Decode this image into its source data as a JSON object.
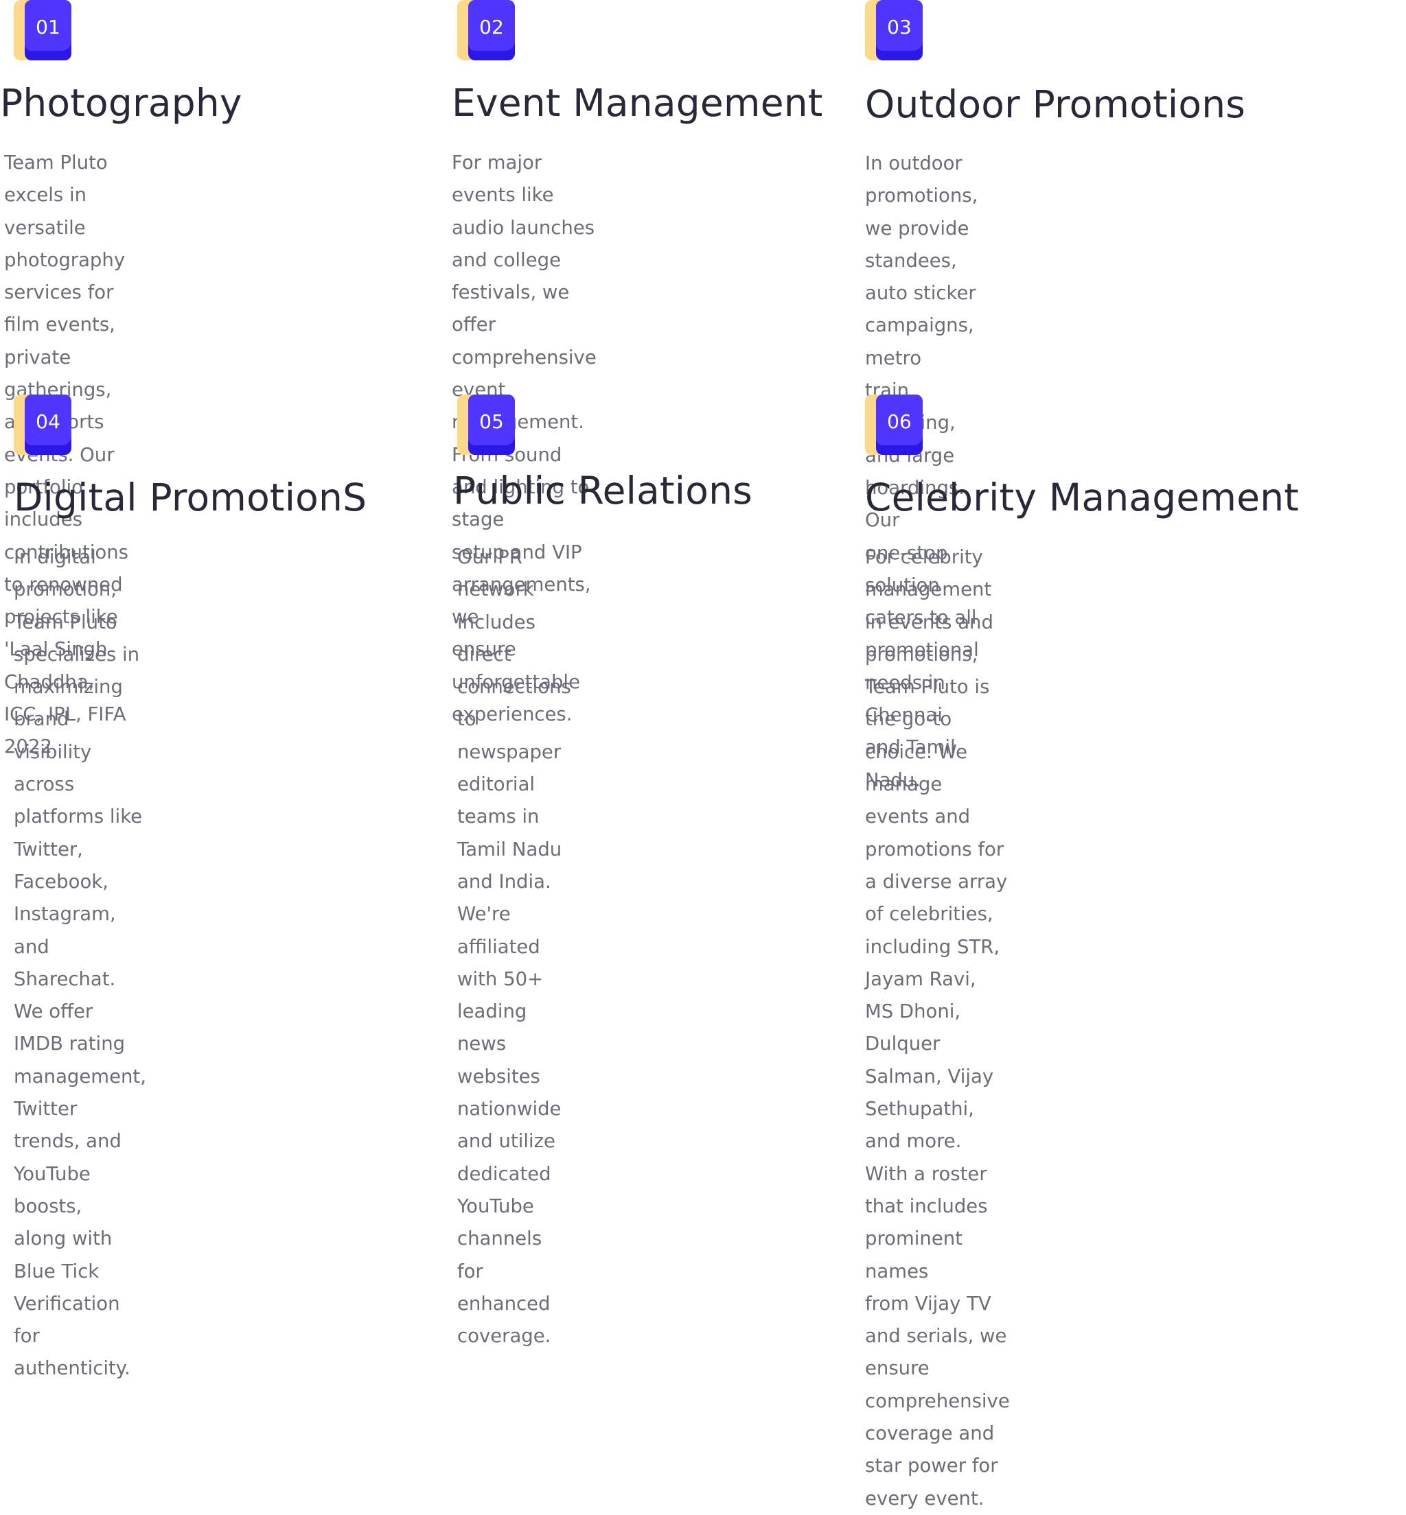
{
  "services": [
    {
      "number": "01",
      "title": "Photography",
      "description": "Team Pluto excels in versatile photography\nservices for film events, private gatherings,\nand sports events. Our portfolio includes\ncontributions to renowned projects like\n'Laal Singh Chaddha, ICC, IPL, FIFA 2022."
    },
    {
      "number": "02",
      "title": "Event Management",
      "description": "For major events like audio launches\nand college festivals, we offer\ncomprehensive event management.\nFrom sound and lighting to stage\nsetup and VIP arrangements, we\nensure unforgettable experiences."
    },
    {
      "number": "03",
      "title": "Outdoor Promotions",
      "description": "In outdoor promotions, we provide\nstandees, auto sticker campaigns, metro\ntrain branding, and large hoardings. Our\none-stop solution caters to all promotional\nneeds in Chennai and Tamil Nadu."
    },
    {
      "number": "04",
      "title": "Digital PromotionS",
      "description": "In digital promotion, Team Pluto\nspecializes in maximizing brand\nvisibility across platforms like Twitter,\nFacebook, Instagram, and Sharechat.\nWe offer IMDB rating management,\nTwitter trends, and YouTube boosts,\nalong with Blue Tick Verification for\nauthenticity."
    },
    {
      "number": "05",
      "title": "Public Relations",
      "description": "Our PR network includes direct\nconnections to newspaper editorial\nteams in Tamil Nadu and India. We're\naffiliated with 50+ leading news\nwebsites nationwide and utilize\ndedicated YouTube channels for\nenhanced coverage."
    },
    {
      "number": "06",
      "title": "Celebrity  Management",
      "description": "For celebrity management in events and promotions,\nTeam Pluto is the go-to choice. We manage events and\npromotions for a diverse array of celebrities, including STR,\nJayam Ravi, MS Dhoni, Dulquer Salman, Vijay Sethupathi,\nand more. With a roster that includes prominent names\nfrom Vijay TV and serials, we ensure comprehensive\ncoverage and star power for every event."
    }
  ],
  "colors": {
    "badge_primary": "#5034ff",
    "badge_shadow": "#2a18e8",
    "badge_accent": "#ffd98a",
    "title": "#272838",
    "body_text": "#6b6d78"
  }
}
